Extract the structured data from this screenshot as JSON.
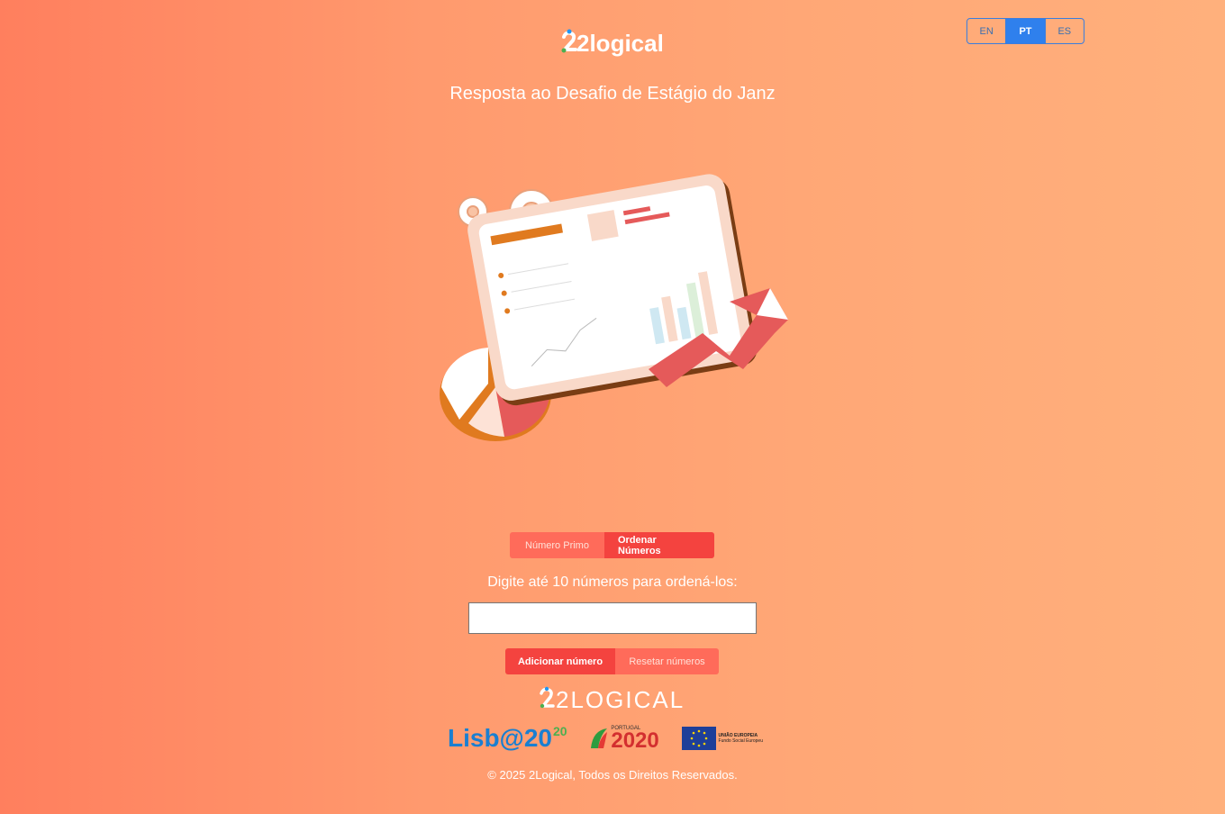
{
  "header": {
    "logo_text": "2logical",
    "subtitle": "Resposta ao Desafio de Estágio do Janz"
  },
  "language": {
    "options": [
      "EN",
      "PT",
      "ES"
    ],
    "selected": "PT"
  },
  "tabs": {
    "prime_label": "Número Primo",
    "sort_label": "Ordenar Números",
    "active": "Ordenar Números"
  },
  "form": {
    "prompt": "Digite até 10 números para ordená-los:",
    "input_value": "",
    "add_label": "Adicionar número",
    "reset_label": "Resetar números"
  },
  "footer": {
    "logo_text": "2LOGICAL",
    "partners": {
      "lisboa": "Lisb@20",
      "lisboa_sup": "20",
      "portugal_small": "PORTUGAL",
      "portugal": "2020",
      "eu_small": "UNIÃO EUROPEIA",
      "eu_sub": "Fundo Social Europeu"
    },
    "copyright": "© 2025 2Logical, Todos os Direitos Reservados."
  },
  "colors": {
    "accent": "#f4433f",
    "accent_light": "#ff6b5a",
    "lang_active": "#2f80ed"
  }
}
